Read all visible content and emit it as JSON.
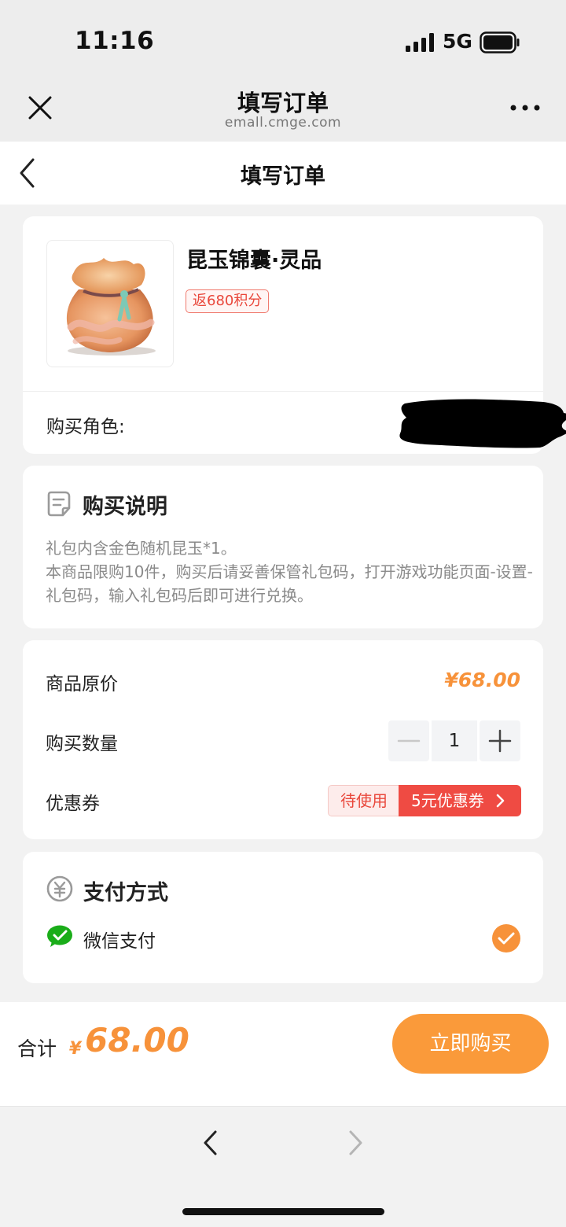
{
  "status_bar": {
    "time": "11:16",
    "network": "5G",
    "icons": [
      "signal-icon",
      "battery-icon"
    ]
  },
  "browser": {
    "title": "填写订单",
    "url": "emall.cmge.com",
    "icons": [
      "close-icon",
      "more-icon"
    ]
  },
  "page": {
    "title": "填写订单"
  },
  "product": {
    "name": "昆玉锦囊·灵品",
    "points_badge": "返680积分",
    "role_label": "购买角色:"
  },
  "description": {
    "heading": "购买说明",
    "text": "礼包内含金色随机昆玉*1。\n本商品限购10件，购买后请妥善保管礼包码，打开游戏功能页面-设置-礼包码，输入礼包码后即可进行兑换。"
  },
  "pricing": {
    "original_price_label": "商品原价",
    "original_price": "¥68.00",
    "quantity_label": "购买数量",
    "quantity": "1",
    "coupon_label": "优惠券",
    "coupon_status": "待使用",
    "coupon_value": "5元优惠券"
  },
  "payment": {
    "heading": "支付方式",
    "method": "微信支付",
    "selected": true
  },
  "footer": {
    "total_label": "合计",
    "currency": "¥",
    "total_amount": "68.00",
    "buy_label": "立即购买"
  },
  "colors": {
    "accent_orange": "#f7923a",
    "coupon_red": "#ef4b43",
    "wechat_green": "#1aad19"
  }
}
